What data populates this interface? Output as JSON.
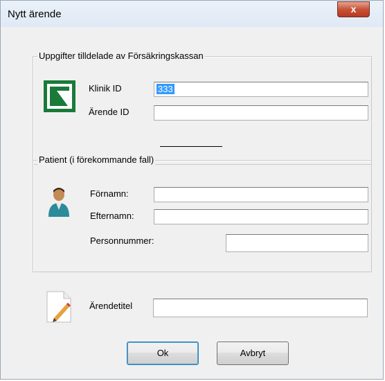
{
  "window": {
    "title": "Nytt ärende",
    "close_label": "x"
  },
  "group1": {
    "legend": "Uppgifter tilldelade av Försäkringskassan",
    "klinik_label": "Klinik ID",
    "klinik_value": "333",
    "arende_label": "Ärende ID",
    "arende_value": "",
    "logo_icon": "forsakringskassan-logo",
    "logo_color": "#1a7a3a"
  },
  "group2": {
    "legend": "Patient (i förekommande fall)",
    "fornamn_label": "Förnamn:",
    "efternamn_label": "Efternamn:",
    "personnummer_label": "Personnummer:",
    "fornamn_value": "",
    "efternamn_value": "",
    "personnummer_value": "",
    "icon": "person-icon"
  },
  "title_field": {
    "label": "Ärendetitel",
    "value": "",
    "icon": "document-edit-icon"
  },
  "buttons": {
    "ok": "Ok",
    "cancel": "Avbryt"
  }
}
